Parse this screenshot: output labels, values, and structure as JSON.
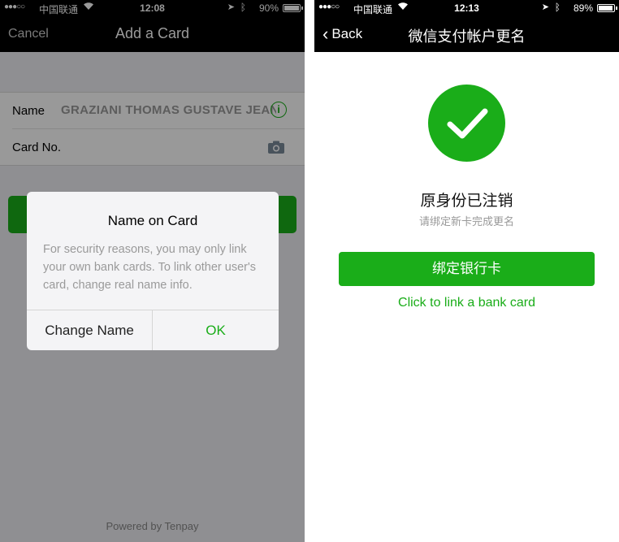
{
  "left": {
    "status": {
      "signal": "●●●○○",
      "carrier": "中国联通",
      "time": "12:08",
      "battery_pct": "90%",
      "battery_level": 0.9
    },
    "nav": {
      "cancel": "Cancel",
      "title": "Add a Card"
    },
    "form": {
      "name_label": "Name",
      "name_value": "GRAZIANI THOMAS GUSTAVE JEAN",
      "card_label": "Card No."
    },
    "footer": "Powered by Tenpay",
    "dialog": {
      "title": "Name on Card",
      "message": "For security reasons, you may only link your own bank cards. To link other user's card, change real name info.",
      "left_button": "Change Name",
      "right_button": "OK"
    }
  },
  "right": {
    "status": {
      "signal": "●●●○○",
      "carrier": "中国联通",
      "time": "12:13",
      "battery_pct": "89%",
      "battery_level": 0.89
    },
    "nav": {
      "back": "Back",
      "title": "微信支付帐户更名"
    },
    "msg_title": "原身份已注销",
    "msg_sub": "请绑定新卡完成更名",
    "bind_button": "绑定银行卡",
    "link_text": "Click to link a bank card"
  },
  "colors": {
    "accent": "#1aad19",
    "bar": "#000000"
  }
}
